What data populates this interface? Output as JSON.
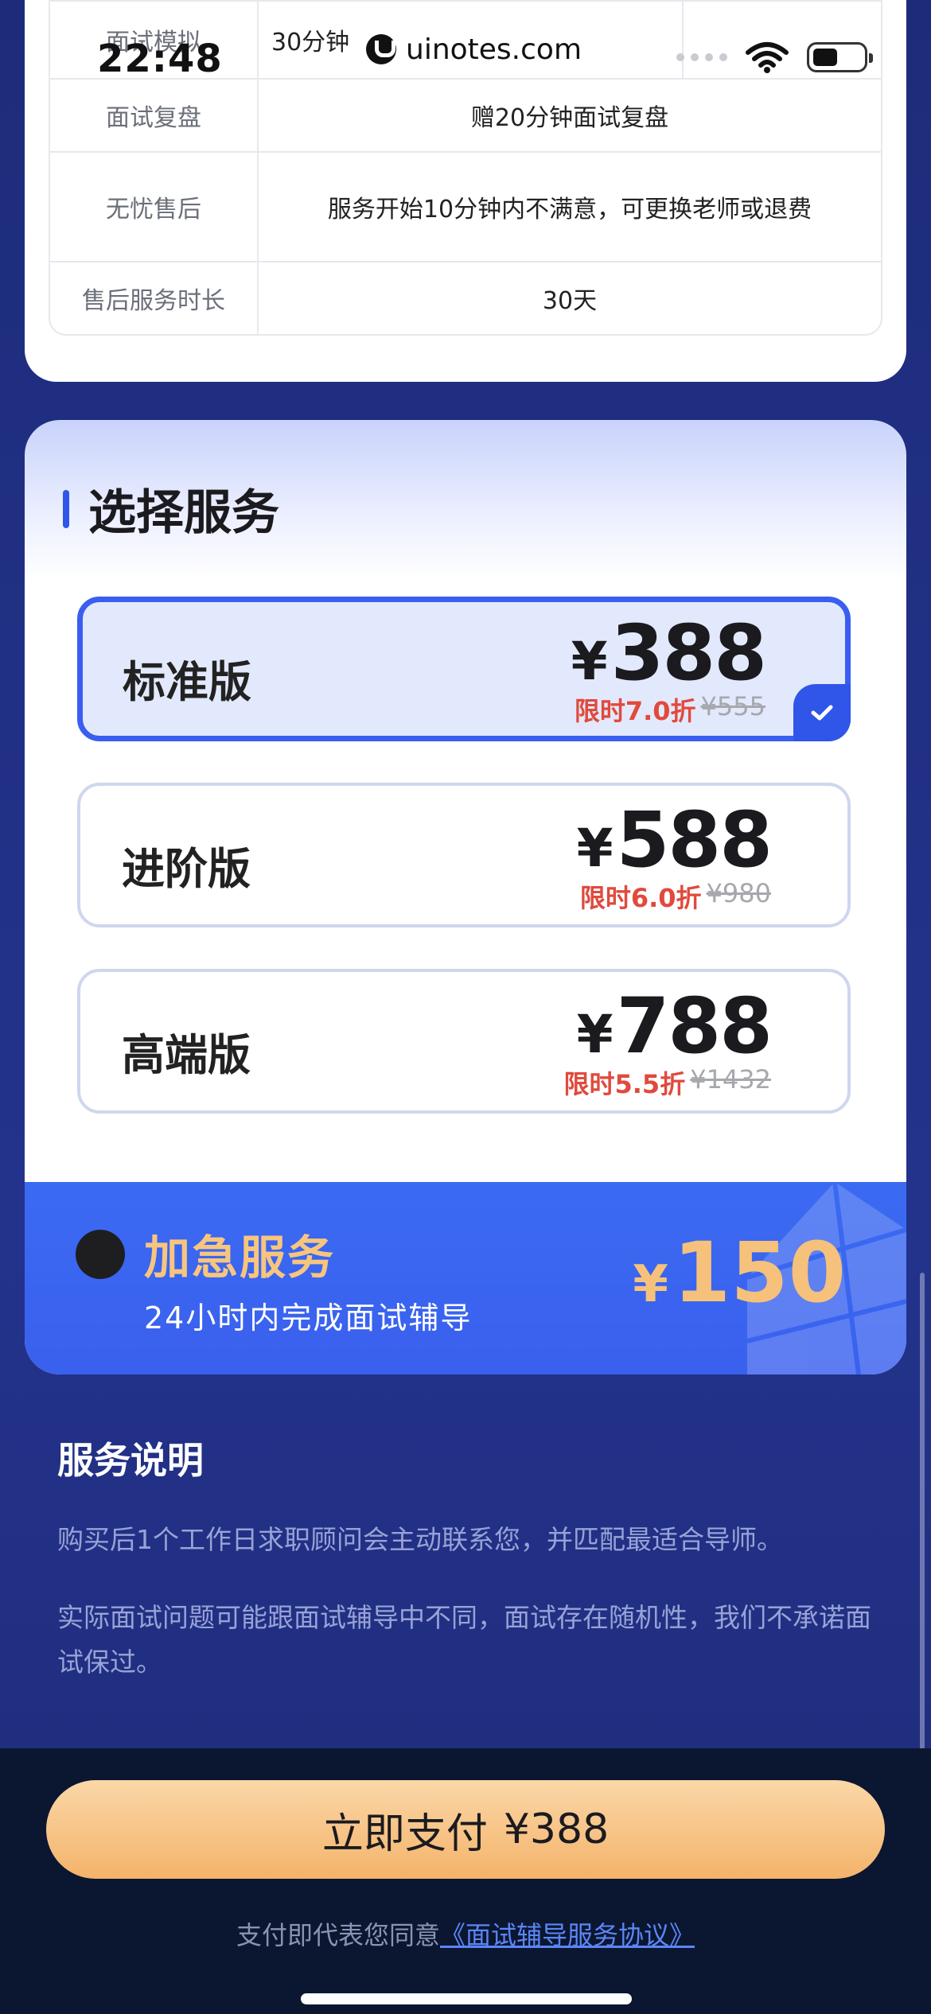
{
  "status_bar": {
    "time": "22:48",
    "pill_text": "uinotes.com"
  },
  "table": {
    "row0": {
      "label": "面试模拟",
      "value": "30分钟"
    },
    "row1": {
      "label": "面试复盘",
      "value": "赠20分钟面试复盘"
    },
    "row2": {
      "label": "无忧售后",
      "value": "服务开始10分钟内不满意，可更换老师或退费"
    },
    "row3": {
      "label": "售后服务时长",
      "value": "30天"
    }
  },
  "select_service": {
    "title": "选择服务",
    "plans": [
      {
        "name": "标准版",
        "currency": "¥",
        "price": "388",
        "discount": "限时7.0折",
        "original": "¥555",
        "selected": true
      },
      {
        "name": "进阶版",
        "currency": "¥",
        "price": "588",
        "discount": "限时6.0折",
        "original": "¥980",
        "selected": false
      },
      {
        "name": "高端版",
        "currency": "¥",
        "price": "788",
        "discount": "限时5.5折",
        "original": "¥1432",
        "selected": false
      }
    ]
  },
  "urgent": {
    "title": "加急服务",
    "subtitle": "24小时内完成面试辅导",
    "currency": "¥",
    "price": "150"
  },
  "notes": {
    "title": "服务说明",
    "line1": "购买后1个工作日求职顾问会主动联系您，并匹配最适合导师。",
    "line2": "实际面试问题可能跟面试辅导中不同，面试存在随机性，我们不承诺面试保过。"
  },
  "footer": {
    "pay_label": "立即支付",
    "pay_amount": "¥388",
    "agree_prefix": "支付即代表您同意",
    "agree_link": "《面试辅导服务协议》"
  },
  "colors": {
    "accent_blue": "#3a5ef0",
    "discount_red": "#e04a3d",
    "gold": "#f7c57e",
    "page_bg": "#23338c"
  }
}
